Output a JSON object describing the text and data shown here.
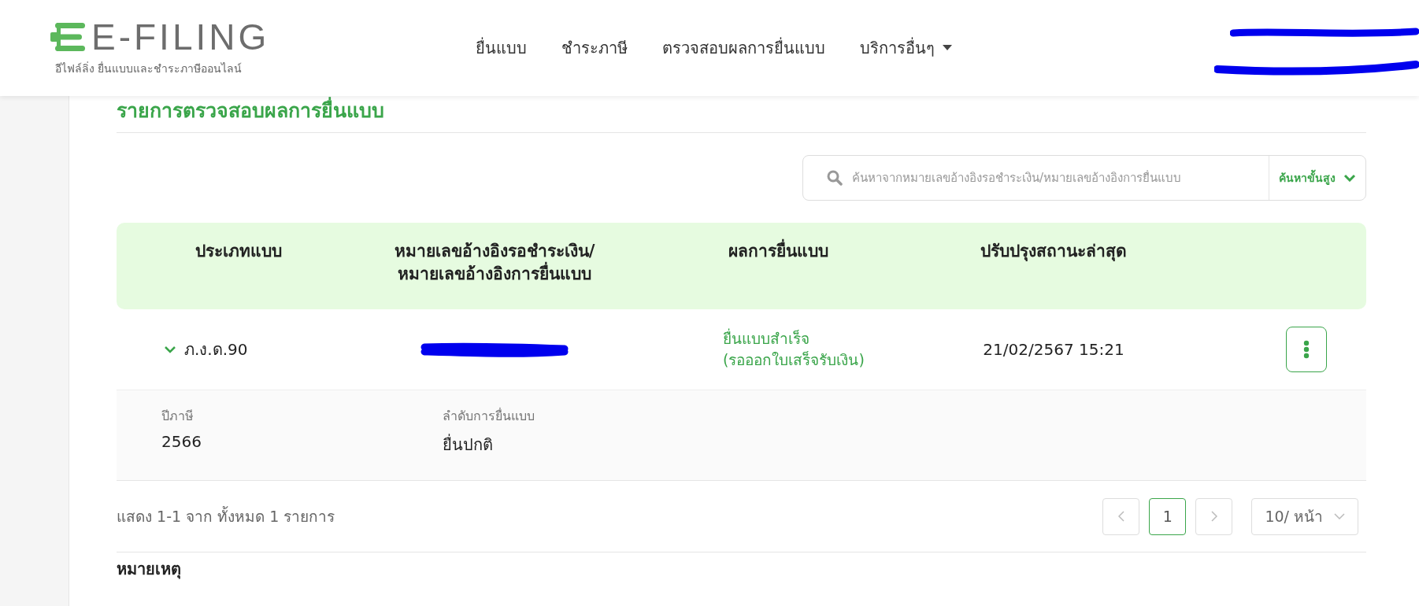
{
  "header": {
    "logo": {
      "wordmark": "E-FILING",
      "tagline": "อีไฟล์ลิ่ง ยื่นแบบและชำระภาษีออนไลน์"
    },
    "nav": [
      {
        "label": "ยื่นแบบ",
        "dropdown": false
      },
      {
        "label": "ชำระภาษี",
        "dropdown": false
      },
      {
        "label": "ตรวจสอบผลการยื่นแบบ",
        "dropdown": false
      },
      {
        "label": "บริการอื่นๆ",
        "dropdown": true
      }
    ]
  },
  "page_title": "รายการตรวจสอบผลการยื่นแบบ",
  "search": {
    "placeholder": "ค้นหาจากหมายเลขอ้างอิงรอชำระเงิน/หมายเลขอ้างอิงการยื่นแบบ",
    "advanced": "ค้นหาขั้นสูง"
  },
  "table": {
    "columns": [
      "ประเภทแบบ",
      "หมายเลขอ้างอิงรอชำระเงิน/\nหมายเลขอ้างอิงการยื่นแบบ",
      "ผลการยื่นแบบ",
      "ปรับปรุงสถานะล่าสุด"
    ],
    "rows": [
      {
        "form": "ภ.ง.ด.90",
        "expanded": true,
        "result": "ยื่นแบบสำเร็จ\n(รอออกใบเสร็จรับเงิน)",
        "updated": "21/02/2567 15:21",
        "details": [
          {
            "label": "ปีภาษี",
            "value": "2566"
          },
          {
            "label": "ลำดับการยื่นแบบ",
            "value": "ยื่นปกติ"
          }
        ]
      }
    ]
  },
  "pagination": {
    "summary": "แสดง 1-1 จาก ทั้งหมด 1 รายการ",
    "pages": [
      {
        "label": "1",
        "selected": true
      }
    ],
    "page_size": "10/ หน้า"
  },
  "remarks_heading": "หมายเหตุ"
}
